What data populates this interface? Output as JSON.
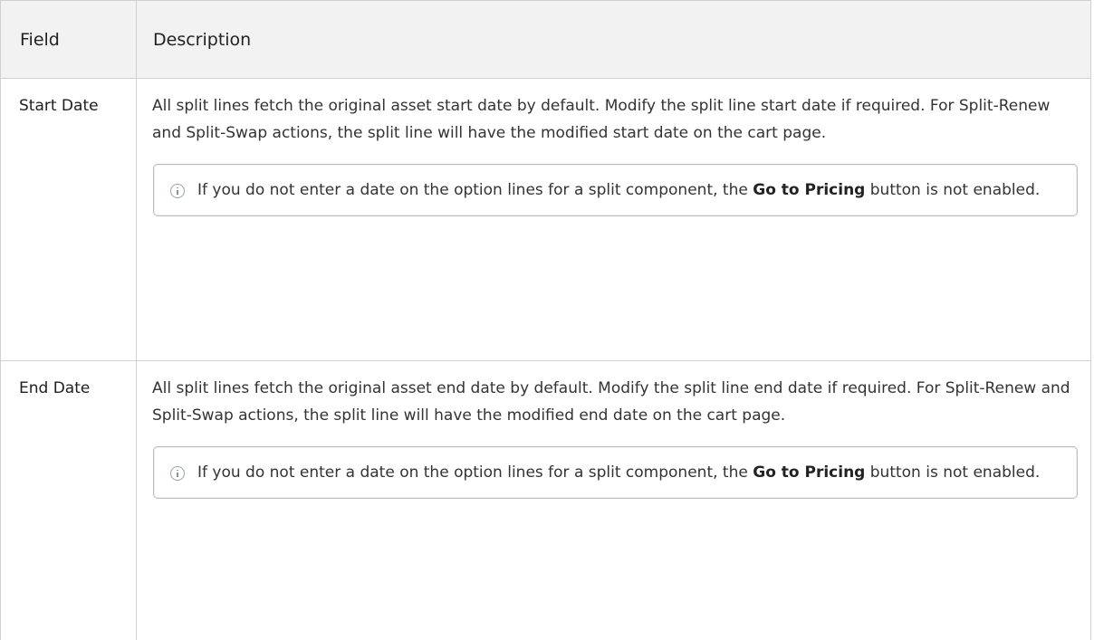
{
  "table": {
    "headers": {
      "field": "Field",
      "description": "Description"
    },
    "rows": [
      {
        "field": "Start Date",
        "description": "All split lines fetch the original asset start date by default. Modify the split line start date if required. For Split-Renew and Split-Swap actions, the split line will have the modified start date on the cart page.",
        "note": {
          "icon": "info-icon",
          "text_before": "If you do not enter a date on the option lines for a split component, the ",
          "emphasis": "Go to Pricing",
          "text_after": " button is not enabled."
        }
      },
      {
        "field": "End Date",
        "description": "All split lines fetch the original asset end date by default. Modify the split line end date if required. For Split-Renew and Split-Swap actions, the split line will have the modified end date on the cart page.",
        "note": {
          "icon": "info-icon",
          "text_before": "If you do not enter a date on the option lines for a split component, the ",
          "emphasis": "Go to Pricing",
          "text_after": " button is not enabled."
        }
      }
    ]
  }
}
